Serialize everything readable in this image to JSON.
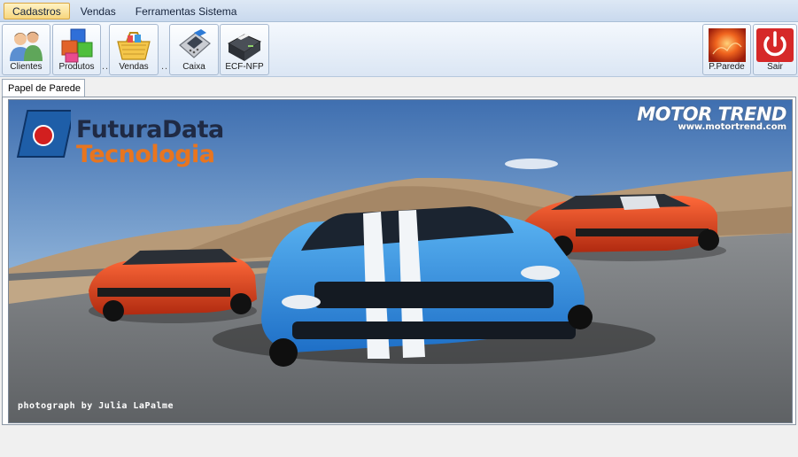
{
  "menu": {
    "items": [
      {
        "label": "Cadastros",
        "active": true
      },
      {
        "label": "Vendas",
        "active": false
      },
      {
        "label": "Ferramentas Sistema",
        "active": false
      }
    ]
  },
  "toolbar": {
    "left_buttons": [
      {
        "label": "Clientes",
        "icon": "clients-icon"
      },
      {
        "label": "Produtos",
        "icon": "products-icon"
      },
      {
        "label": "Vendas",
        "icon": "sales-basket-icon"
      },
      {
        "label": "Caixa",
        "icon": "card-terminal-icon"
      },
      {
        "label": "ECF-NFP",
        "icon": "fiscal-printer-icon"
      }
    ],
    "separator": "..",
    "right_buttons": [
      {
        "label": "P.Parede",
        "icon": "wallpaper-icon"
      },
      {
        "label": "Sair",
        "icon": "power-icon"
      }
    ]
  },
  "tabs": [
    {
      "label": "Papel de Parede",
      "selected": true
    }
  ],
  "wallpaper": {
    "logo_line1": "FuturaData",
    "logo_line2": "Tecnologia",
    "brand_name": "MOTOR TREND",
    "brand_url": "www.motortrend.com",
    "photo_credit": "photograph by Julia LaPalme"
  },
  "colors": {
    "menu_bar": "#c9d9ee",
    "active_menu": "#f7d67e",
    "logo_accent": "#e8751f",
    "exit_red": "#d62828"
  }
}
